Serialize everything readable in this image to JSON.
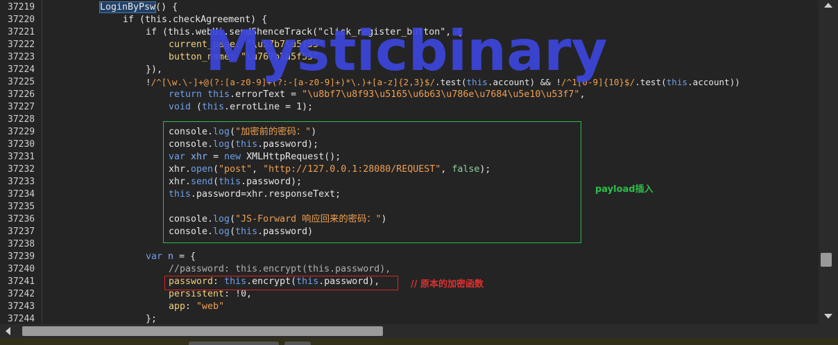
{
  "line_numbers": [
    "37219",
    "37220",
    "37221",
    "37222",
    "37223",
    "37224",
    "37225",
    "37226",
    "37227",
    "37228",
    "37229",
    "37230",
    "37231",
    "37232",
    "37233",
    "37234",
    "37235",
    "37236",
    "37237",
    "37238",
    "37239",
    "37240",
    "37241",
    "37242",
    "37243",
    "37244"
  ],
  "code": {
    "l1_fn": "LoginByPsw",
    "l1_rest": "() {",
    "l2": "if (this.checkAgreement) {",
    "l3": "if (this.webUi.sendShenceTrack(\"click_register_button\", {",
    "l4": "current_page: \"\\u57b7\\u5f55\"",
    "l5": "button_name: \"\\u767b\\u5f55\"",
    "l6": "}),",
    "l7_prefix": "!",
    "l7_regex1": "/^[\\w.\\-]+@(?:[a-z0-9]+(?:-[a-z0-9]+)*\\.)+[a-z]{2,3}$/",
    "l7_mid1": ".test(",
    "l7_this1": "this",
    "l7_mid2": ".account) && !",
    "l7_regex2": "/^1[0-9]{10}$/",
    "l7_mid3": ".test(",
    "l7_this2": "this",
    "l7_end": ".account))",
    "l8_kw": "return",
    "l8_this": "this",
    "l8_mid": ".errorText = ",
    "l8_str": "\"\\u8bf7\\u8f93\\u5165\\u6b63\\u786e\\u7684\\u5e10\\u53f7\"",
    "l8_end": ",",
    "l9_kw": "void",
    "l9_mid1": " (",
    "l9_this": "this",
    "l9_end": ".errotLine = 1);",
    "p1_a": "console.",
    "p1_fn": "log",
    "p1_b": "(",
    "p1_str": "\"加密前的密码：\"",
    "p1_c": ")",
    "p2_a": "console.",
    "p2_fn": "log",
    "p2_b": "(",
    "p2_this": "this",
    "p2_c": ".password);",
    "p3_kw": "var",
    "p3_var": "xhr",
    "p3_mid": " = ",
    "p3_kw2": "new",
    "p3_end": " XMLHttpRequest();",
    "p4_a": "xhr.",
    "p4_fn": "open",
    "p4_b": "(",
    "p4_str1": "\"post\"",
    "p4_c": ", ",
    "p4_str2": "\"http://127.0.0.1:28080/REQUEST\"",
    "p4_d": ", ",
    "p4_lit": "false",
    "p4_e": ");",
    "p5_a": "xhr.",
    "p5_fn": "send",
    "p5_b": "(",
    "p5_this": "this",
    "p5_c": ".password);",
    "p6_this": "this",
    "p6_rest": ".password=xhr.responseText;",
    "p8_a": "console.",
    "p8_fn": "log",
    "p8_b": "(",
    "p8_str": "\"JS-Forward 响应回来的密码：\"",
    "p8_c": ")",
    "p9_a": "console.",
    "p9_fn": "log",
    "p9_b": "(",
    "p9_this": "this",
    "p9_c": ".password)",
    "v1_kw": "var",
    "v1_var": "n",
    "v1_rest": " = {",
    "v2": "//password: this.encrypt(this.password),",
    "v3_prop": "password",
    "v3_a": ": ",
    "v3_this1": "this",
    "v3_b": ".",
    "v3_fn": "encrypt",
    "v3_c": "(",
    "v3_this2": "this",
    "v3_d": ".password),",
    "v4_prop": "persistent",
    "v4_rest": ": !0,",
    "v5_prop": "app",
    "v5_a": ": ",
    "v5_str": "\"web\"",
    "v6": "};"
  },
  "annotations": {
    "payload": "payload插入",
    "original": "// 原本的加密函数"
  },
  "watermark": "Mysticbinary",
  "colors": {
    "background": "#242424",
    "keyword": "#6ea0e8",
    "string": "#f0a050",
    "payload_box": "#2dbd4a",
    "original_box": "#e02020",
    "watermark": "#3c46dc"
  }
}
